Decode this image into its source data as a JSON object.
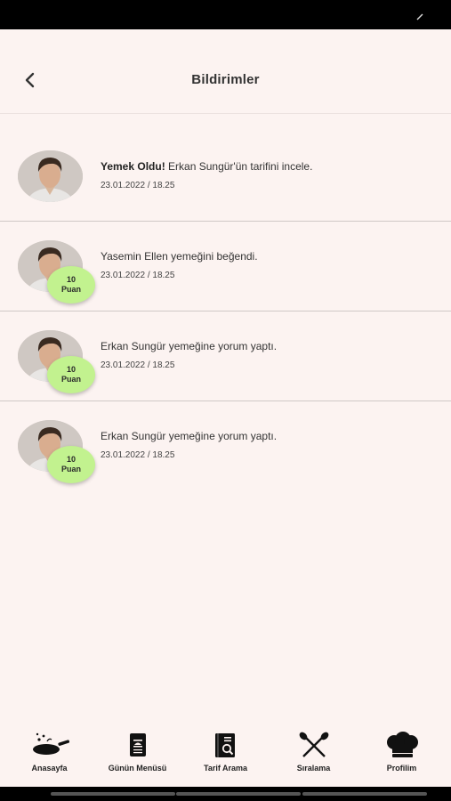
{
  "header": {
    "title": "Bildirimler"
  },
  "notifications": [
    {
      "bold": "Yemek Oldu!",
      "text": " Erkan Sungür'ün tarifini incele.",
      "date": "23.01.2022 / 18.25"
    },
    {
      "bold": "",
      "text": "Yasemin Ellen yemeğini beğendi.",
      "date": "23.01.2022 / 18.25",
      "points_value": "10",
      "points_label": "Puan"
    },
    {
      "bold": "",
      "text": "Erkan Sungür yemeğine yorum yaptı.",
      "date": "23.01.2022 / 18.25",
      "points_value": "10",
      "points_label": "Puan"
    },
    {
      "bold": "",
      "text": "Erkan Sungür yemeğine yorum yaptı.",
      "date": "23.01.2022 / 18.25",
      "points_value": "10",
      "points_label": "Puan"
    }
  ],
  "bottom_nav": [
    {
      "label": "Anasayfa",
      "icon": "frying-pan-icon"
    },
    {
      "label": "Günün Menüsü",
      "icon": "menu-book-icon"
    },
    {
      "label": "Tarif Arama",
      "icon": "recipe-search-icon"
    },
    {
      "label": "Sıralama",
      "icon": "crossed-spoons-icon"
    },
    {
      "label": "Profilim",
      "icon": "chef-hat-icon"
    }
  ],
  "colors": {
    "background": "#fcf3f1",
    "badge": "#c2f28f",
    "text": "#333333"
  }
}
